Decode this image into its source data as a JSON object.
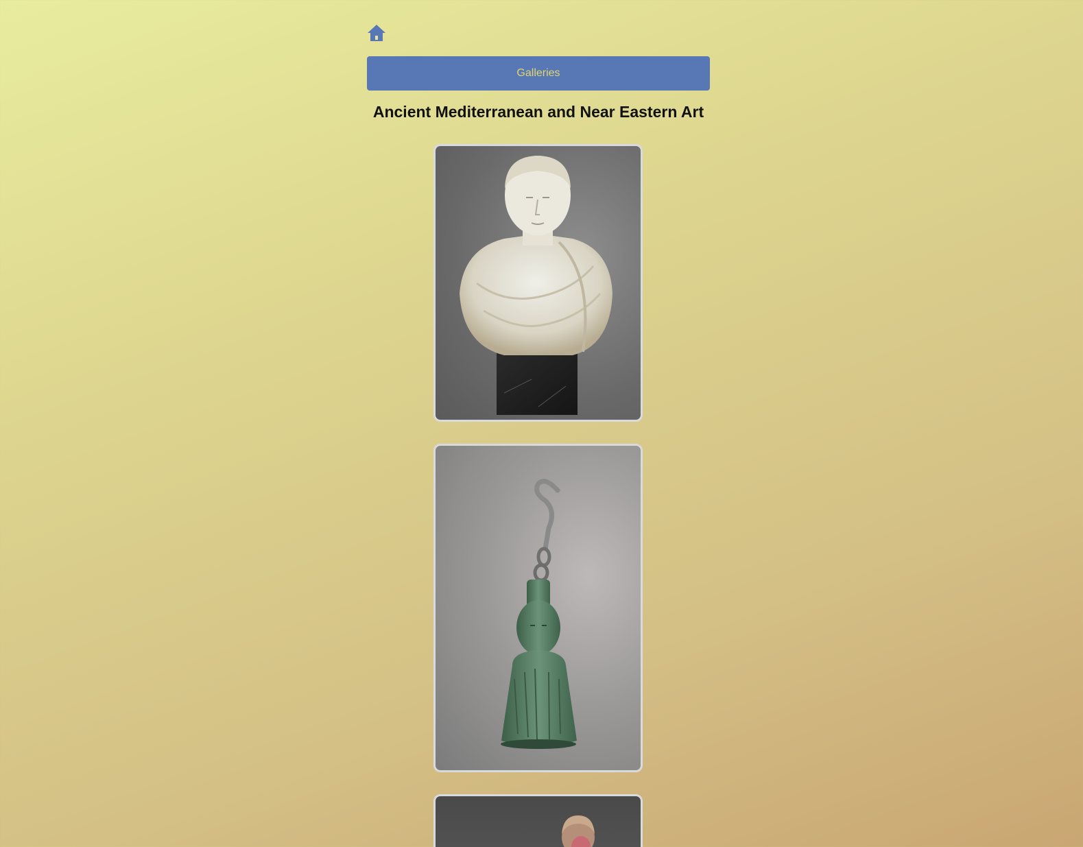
{
  "nav": {
    "home_icon": "home-icon",
    "galleries_label": "Galleries"
  },
  "page": {
    "title": "Ancient Mediterranean and Near Eastern Art"
  },
  "colors": {
    "accent": "#5778b5",
    "button_text": "#e2d66e",
    "card_border": "#d8dade"
  },
  "artworks": [
    {
      "subject": "marble bust on dark stone base"
    },
    {
      "subject": "green bronze bust weight with iron hook"
    },
    {
      "subject": "terracotta head with curly hair"
    }
  ]
}
